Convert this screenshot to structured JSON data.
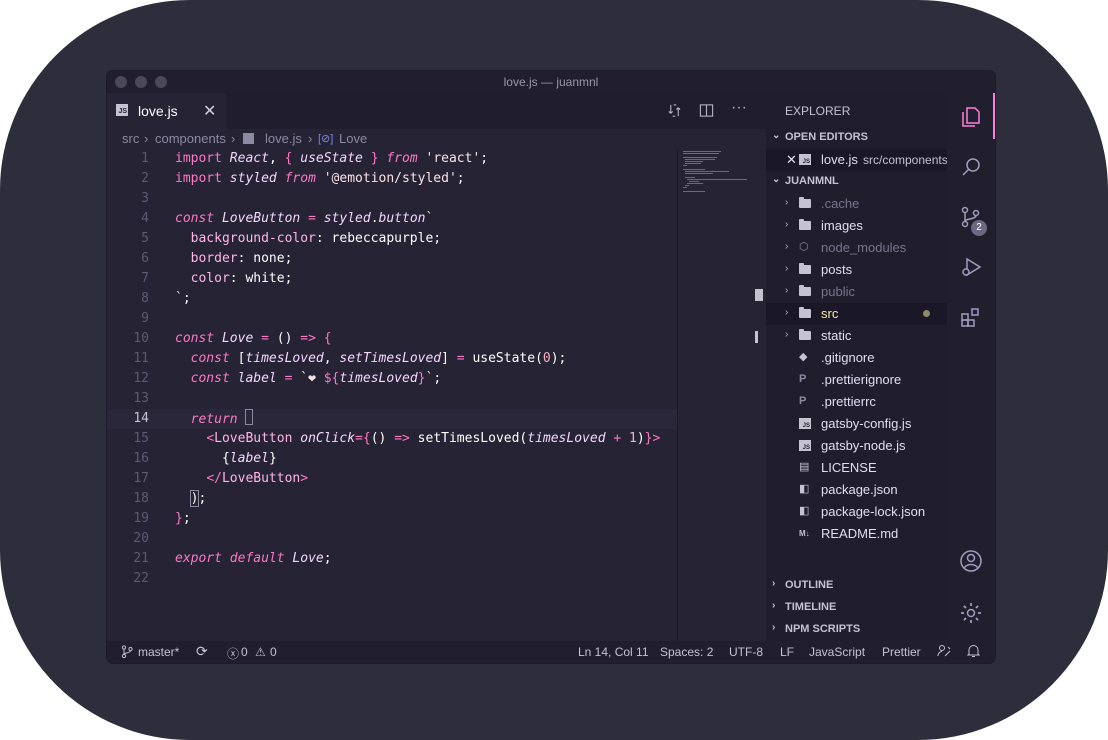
{
  "window": {
    "title": "love.js — juanmnl"
  },
  "tab": {
    "label": "love.js",
    "icon": "js-file-icon",
    "close_glyph": "✕"
  },
  "breadcrumbs": [
    "src",
    "components",
    "love.js",
    "Love"
  ],
  "code": {
    "line_numbers": [
      "1",
      "2",
      "3",
      "4",
      "5",
      "6",
      "7",
      "8",
      "9",
      "10",
      "11",
      "12",
      "13",
      "14",
      "15",
      "16",
      "17",
      "18",
      "19",
      "20",
      "21",
      "22"
    ]
  },
  "explorer": {
    "title": "EXPLORER",
    "open_editors_label": "OPEN EDITORS",
    "open_editor": {
      "name": "love.js",
      "path": "src/components"
    },
    "root_label": "JUANMNL",
    "items": [
      {
        "name": ".cache",
        "type": "folder",
        "dim": true
      },
      {
        "name": "images",
        "type": "folder"
      },
      {
        "name": "node_modules",
        "type": "folder-node",
        "dim": true
      },
      {
        "name": "posts",
        "type": "folder"
      },
      {
        "name": "public",
        "type": "folder",
        "dim": true
      },
      {
        "name": "src",
        "type": "folder",
        "modified": true
      },
      {
        "name": "static",
        "type": "folder"
      },
      {
        "name": ".gitignore",
        "type": "git"
      },
      {
        "name": ".prettierignore",
        "type": "prettier"
      },
      {
        "name": ".prettierrc",
        "type": "prettier"
      },
      {
        "name": "gatsby-config.js",
        "type": "js"
      },
      {
        "name": "gatsby-node.js",
        "type": "js"
      },
      {
        "name": "LICENSE",
        "type": "license"
      },
      {
        "name": "package.json",
        "type": "json"
      },
      {
        "name": "package-lock.json",
        "type": "json"
      },
      {
        "name": "README.md",
        "type": "markdown"
      }
    ],
    "outline_label": "OUTLINE",
    "timeline_label": "TIMELINE",
    "npm_scripts_label": "NPM SCRIPTS"
  },
  "activity_bar": {
    "source_control_badge": "2"
  },
  "status": {
    "branch": "master*",
    "errors": "0",
    "warnings": "0",
    "cursor": "Ln 14, Col 11",
    "spaces": "Spaces: 2",
    "encoding": "UTF-8",
    "eol": "LF",
    "language": "JavaScript",
    "formatter": "Prettier"
  },
  "colors": {
    "editor_bg": "#262335",
    "sidebar_bg": "#201e2d",
    "keyword": "#fe78c6",
    "accent": "#ff7edb",
    "badge": "#6b6880"
  }
}
